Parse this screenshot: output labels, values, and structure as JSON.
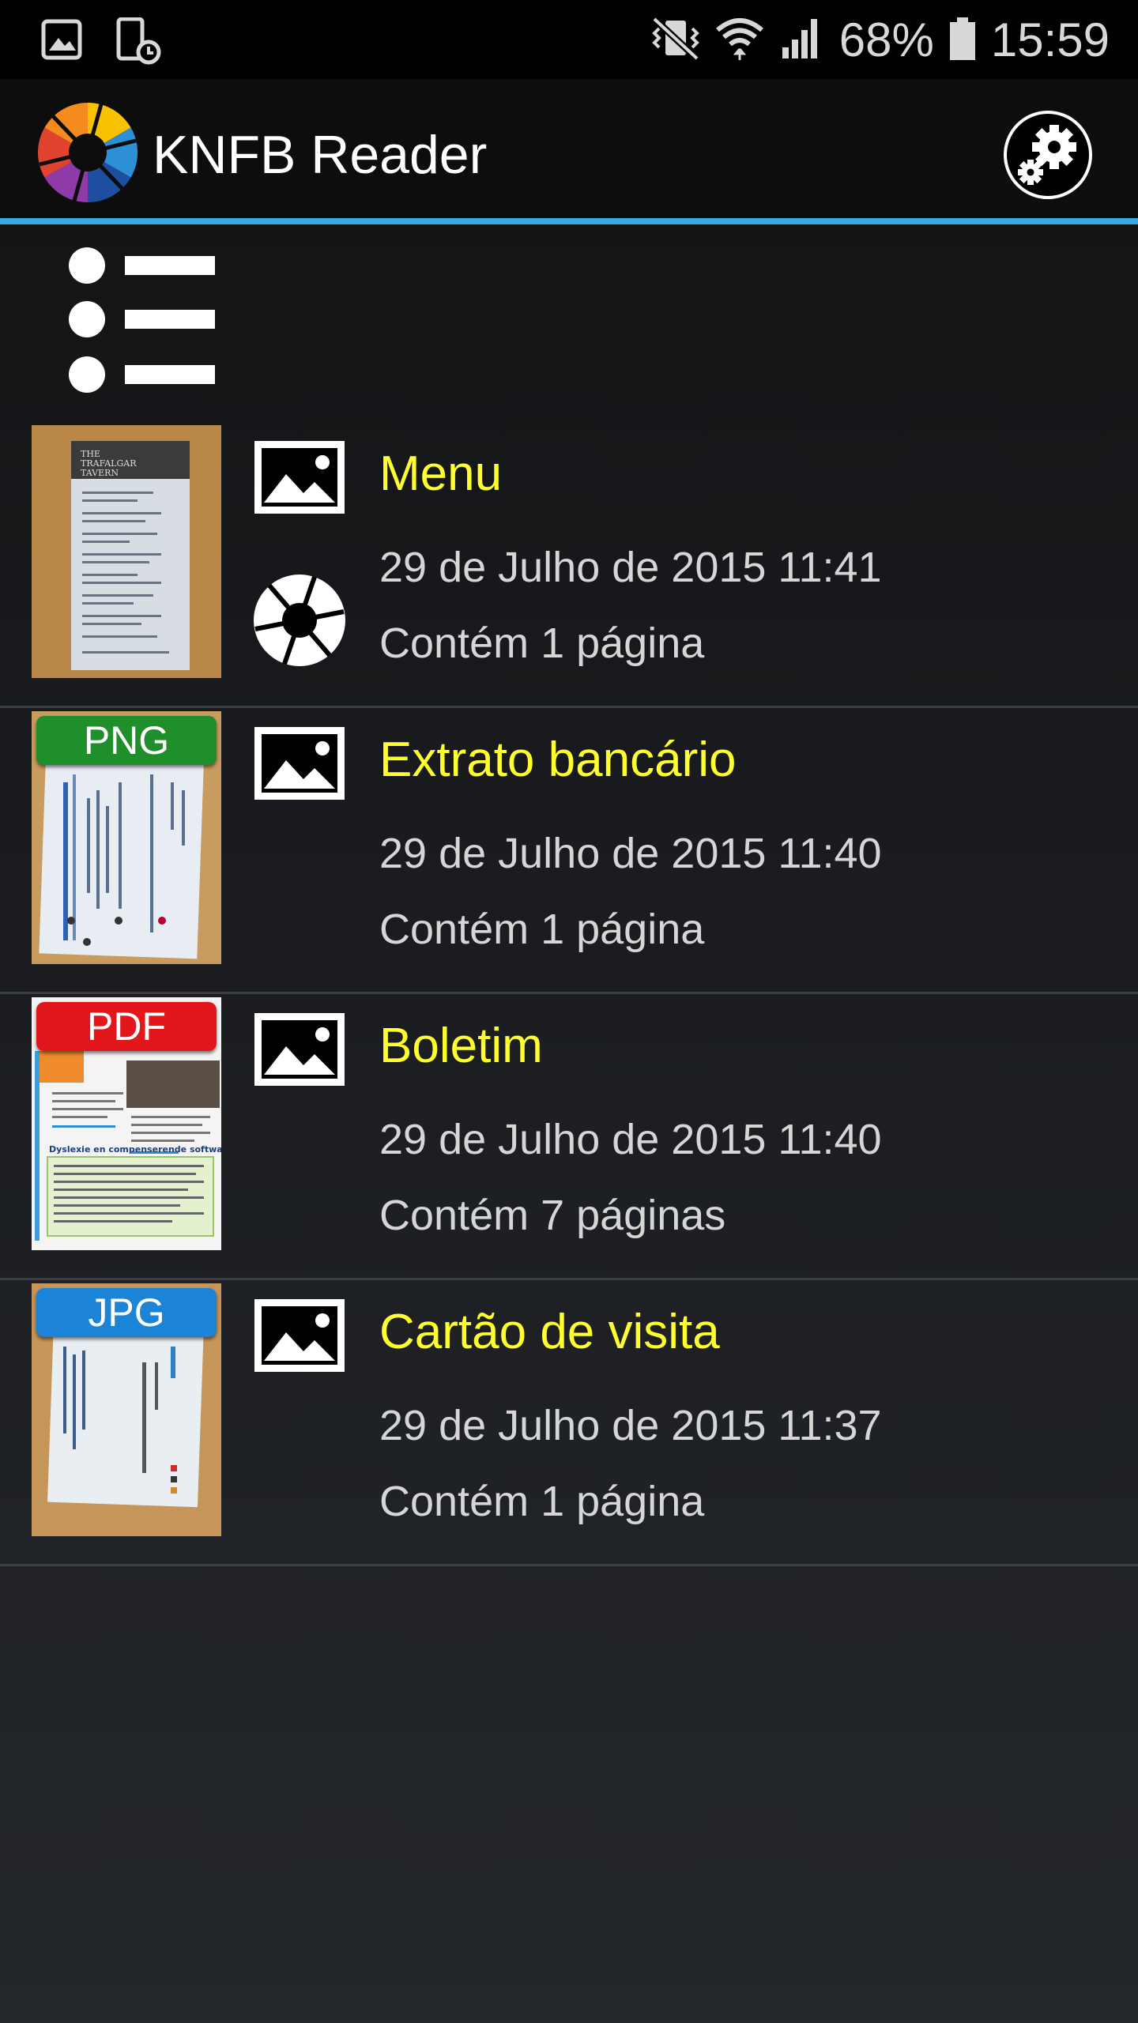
{
  "status_bar": {
    "battery": "68%",
    "time": "15:59",
    "icons": [
      "gallery-icon",
      "phone-schedule-icon",
      "vibrate-mute-icon",
      "wifi-icon",
      "signal-icon",
      "battery-icon"
    ]
  },
  "app_bar": {
    "title": "KNFB Reader",
    "settings_icon": "gears-icon"
  },
  "documents": [
    {
      "title": "Menu",
      "date": "29 de Julho de 2015 11:41",
      "pages": "Contém 1 página",
      "badge": "",
      "type_icon": "image-icon",
      "source_icon": "camera-aperture-icon"
    },
    {
      "title": "Extrato bancário",
      "date": "29 de Julho de 2015 11:40",
      "pages": "Contém 1 página",
      "badge": "PNG",
      "badge_color": "#1f8f2b",
      "type_icon": "image-icon"
    },
    {
      "title": "Boletim",
      "date": "29 de Julho de 2015 11:40",
      "pages": "Contém 7 páginas",
      "badge": "PDF",
      "badge_color": "#e3161b",
      "type_icon": "image-icon"
    },
    {
      "title": "Cartão de visita",
      "date": "29 de Julho de 2015 11:37",
      "pages": "Contém 1 página",
      "badge": "JPG",
      "badge_color": "#1b84d6",
      "type_icon": "image-icon"
    }
  ],
  "colors": {
    "accent": "#36a9e1",
    "title_yellow": "#ffff2e",
    "text_gray": "#d6d6d6"
  }
}
